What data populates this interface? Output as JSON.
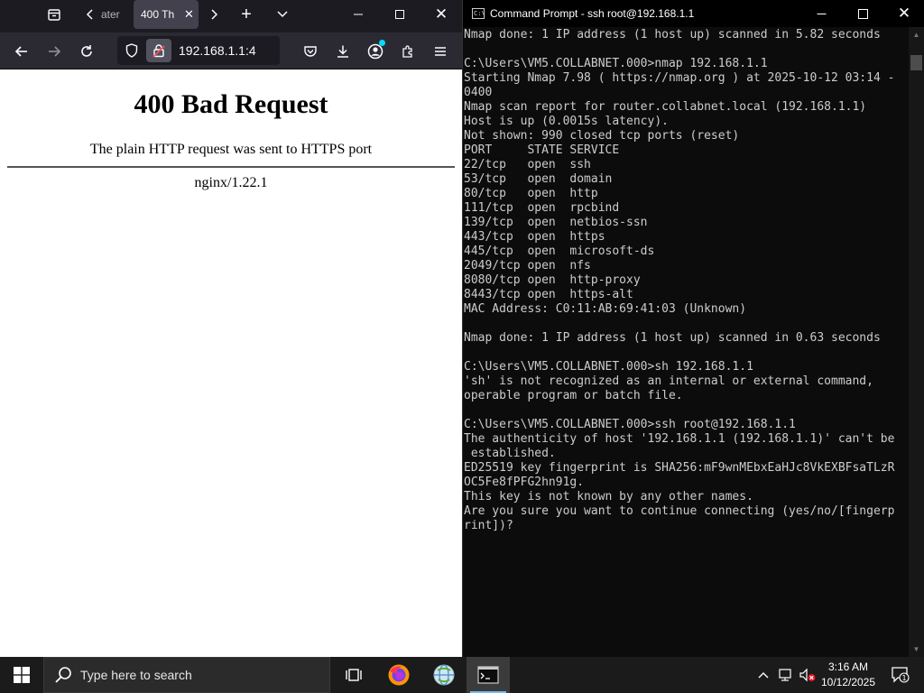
{
  "browser": {
    "tabs": [
      {
        "label": "ater",
        "active": false
      },
      {
        "label": "400 Th",
        "active": true
      }
    ],
    "url": "192.168.1.1:4",
    "icons": {
      "tab_list": "tab-list-icon",
      "back": "arrow-left-icon",
      "forward": "arrow-right-icon",
      "reload": "reload-icon",
      "shield": "shield-icon",
      "lock": "lock-warning-icon",
      "bookmark": "star-icon",
      "pocket": "pocket-icon",
      "downloads": "download-icon",
      "account": "account-icon",
      "extensions": "puzzle-icon",
      "menu": "hamburger-icon"
    },
    "page": {
      "title": "400 Bad Request",
      "message": "The plain HTTP request was sent to HTTPS port",
      "server": "nginx/1.22.1"
    },
    "colors": {
      "chrome_dark": "#1c1b22",
      "toolbar": "#2b2a33",
      "lock_warning": "#ff4f5e"
    }
  },
  "terminal": {
    "title": "Command Prompt - ssh  root@192.168.1.1",
    "lines": [
      "Nmap done: 1 IP address (1 host up) scanned in 5.82 seconds",
      "",
      "C:\\Users\\VM5.COLLABNET.000>nmap 192.168.1.1",
      "Starting Nmap 7.98 ( https://nmap.org ) at 2025-10-12 03:14 -",
      "0400",
      "Nmap scan report for router.collabnet.local (192.168.1.1)",
      "Host is up (0.0015s latency).",
      "Not shown: 990 closed tcp ports (reset)",
      "PORT     STATE SERVICE",
      "22/tcp   open  ssh",
      "53/tcp   open  domain",
      "80/tcp   open  http",
      "111/tcp  open  rpcbind",
      "139/tcp  open  netbios-ssn",
      "443/tcp  open  https",
      "445/tcp  open  microsoft-ds",
      "2049/tcp open  nfs",
      "8080/tcp open  http-proxy",
      "8443/tcp open  https-alt",
      "MAC Address: C0:11:AB:69:41:03 (Unknown)",
      "",
      "Nmap done: 1 IP address (1 host up) scanned in 0.63 seconds",
      "",
      "C:\\Users\\VM5.COLLABNET.000>sh 192.168.1.1",
      "'sh' is not recognized as an internal or external command,",
      "operable program or batch file.",
      "",
      "C:\\Users\\VM5.COLLABNET.000>ssh root@192.168.1.1",
      "The authenticity of host '192.168.1.1 (192.168.1.1)' can't be",
      " established.",
      "ED25519 key fingerprint is SHA256:mF9wnMEbxEaHJc8VkEXBFsaTLzR",
      "OC5Fe8fPFG2hn91g.",
      "This key is not known by any other names.",
      "Are you sure you want to continue connecting (yes/no/[fingerp",
      "rint])?"
    ],
    "icons": {
      "app": "cmd-icon",
      "minimize": "minimize-icon",
      "maximize": "maximize-icon",
      "close": "close-icon"
    },
    "colors": {
      "background": "#0c0c0c",
      "text": "#cccccc"
    }
  },
  "taskbar": {
    "search_placeholder": "Type here to search",
    "clock_time": "3:16 AM",
    "clock_date": "10/12/2025",
    "notification_count": "1",
    "icons": {
      "start": "windows-logo-icon",
      "search": "search-icon",
      "task_view": "task-view-icon",
      "firefox": "firefox-icon",
      "app3": "globe-app-icon",
      "cmd": "cmd-icon",
      "tray_chevron": "chevron-up-icon",
      "network": "network-icon",
      "volume": "volume-muted-icon",
      "notifications": "notification-icon"
    },
    "colors": {
      "taskbar": "#1b1b1b",
      "accent": "#76b9ed"
    }
  }
}
